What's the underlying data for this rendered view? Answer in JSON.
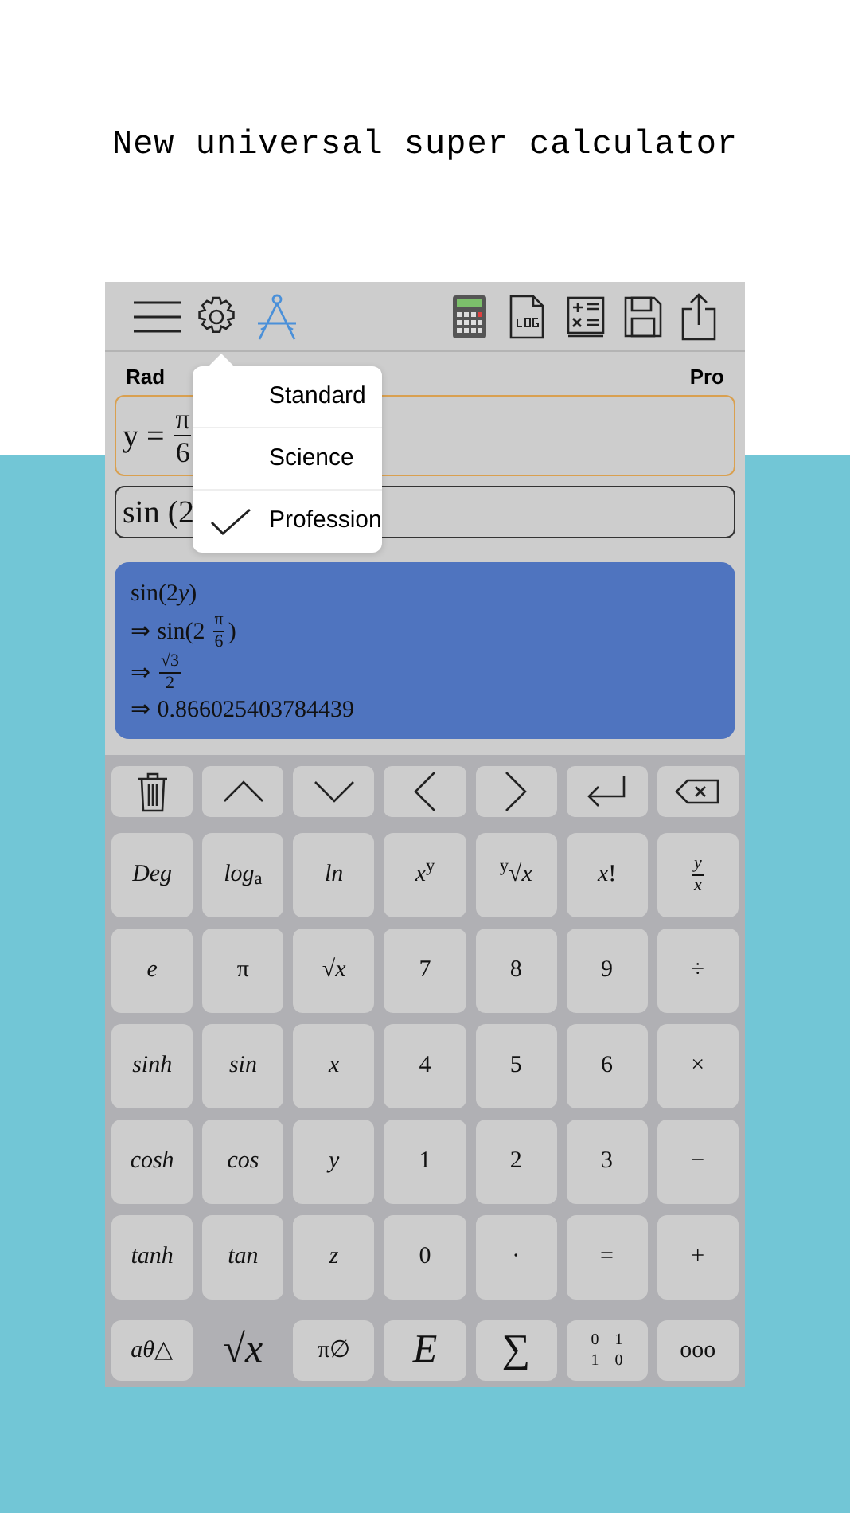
{
  "headline": "New universal super calculator",
  "status": {
    "angle_mode": "Rad",
    "edition": "Pro"
  },
  "mode_menu": [
    {
      "label": "Standard",
      "selected": false
    },
    {
      "label": "Science",
      "selected": false
    },
    {
      "label": "Profession",
      "selected": true
    }
  ],
  "inputs": [
    {
      "prefix": "y =",
      "numerator": "π",
      "denominator": "6",
      "focused": true
    },
    {
      "prefix": "sin (2",
      "focused": false
    }
  ],
  "result_lines": [
    {
      "prefix": "sin(2",
      "variable": "y",
      "suffix": ")"
    },
    {
      "prefix": "⇒ sin(2",
      "numerator": "π",
      "denominator": "6",
      "suffix": ")"
    },
    {
      "prefix": "⇒",
      "numerator": "√3",
      "denominator": "2"
    },
    {
      "prefix": "⇒ 0.866025403784439"
    }
  ],
  "keypad": [
    [
      {
        "label": "*Deg*"
      },
      {
        "label": "*log*$_{a}$"
      },
      {
        "label": "*ln*"
      },
      {
        "label": "*x*$^{y}$"
      },
      {
        "label": "$^{y}$√*x*"
      },
      {
        "label": "*x*!"
      },
      {
        "kind": "fraction",
        "numerator": "y",
        "denominator": "x"
      }
    ],
    [
      {
        "label": "*e*"
      },
      {
        "label": "π"
      },
      {
        "label": "√*x*"
      },
      {
        "label": "7"
      },
      {
        "label": "8"
      },
      {
        "label": "9"
      },
      {
        "label": "÷"
      }
    ],
    [
      {
        "label": "*sinh*"
      },
      {
        "label": "*sin*"
      },
      {
        "label": "*x*"
      },
      {
        "label": "4"
      },
      {
        "label": "5"
      },
      {
        "label": "6"
      },
      {
        "label": "×"
      }
    ],
    [
      {
        "label": "*cosh*"
      },
      {
        "label": "*cos*"
      },
      {
        "label": "*y*"
      },
      {
        "label": "1"
      },
      {
        "label": "2"
      },
      {
        "label": "3"
      },
      {
        "label": "−"
      }
    ],
    [
      {
        "label": "*tanh*"
      },
      {
        "label": "*tan*"
      },
      {
        "label": "*z*"
      },
      {
        "label": "0"
      },
      {
        "label": "·"
      },
      {
        "label": "="
      },
      {
        "label": "+"
      }
    ]
  ],
  "bottom_keys": [
    {
      "kind": "text",
      "label": "*aθ*△",
      "flat": false
    },
    {
      "kind": "big",
      "label": "√*x*",
      "flat": true
    },
    {
      "kind": "text",
      "label": "π∅",
      "flat": false
    },
    {
      "kind": "big",
      "label": "*E*",
      "flat": false
    },
    {
      "kind": "big",
      "label": "∑",
      "flat": false
    },
    {
      "kind": "matrix",
      "cells": [
        "0",
        "1",
        "1",
        "0"
      ],
      "flat": false
    },
    {
      "kind": "text",
      "label": "ooo",
      "flat": false
    }
  ]
}
